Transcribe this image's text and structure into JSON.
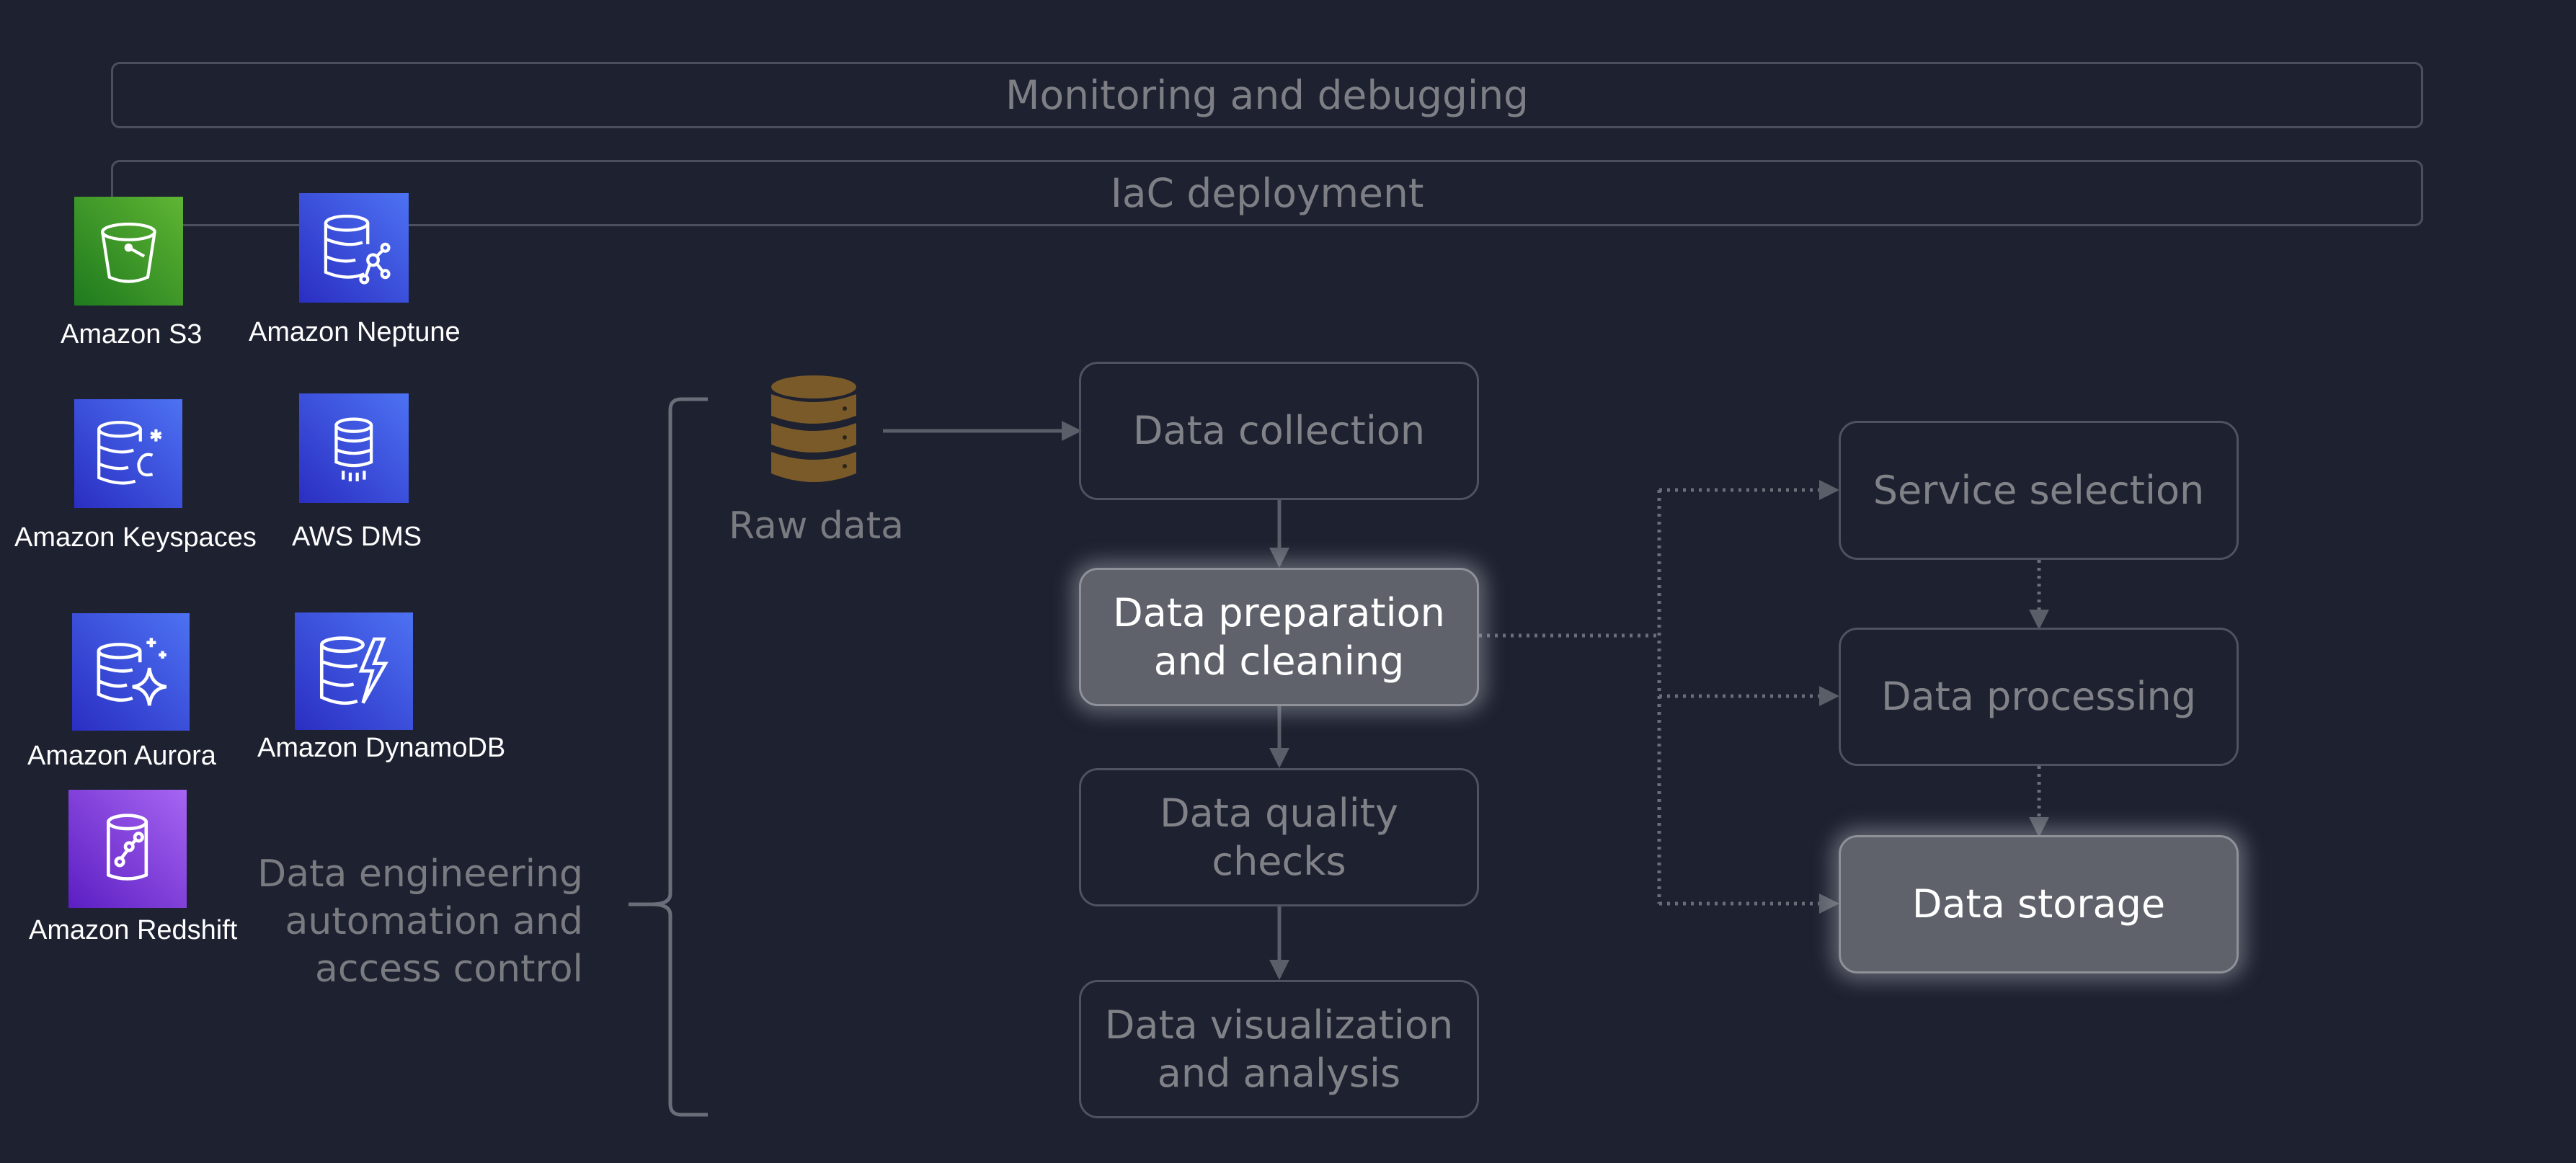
{
  "bars": {
    "monitoring": "Monitoring and debugging",
    "iac": "IaC deployment"
  },
  "services": [
    {
      "label": "Amazon S3",
      "icon": "s3-bucket-icon",
      "color": "#3f8624"
    },
    {
      "label": "Amazon Neptune",
      "icon": "neptune-graph-database-icon",
      "color": "#3b48cc"
    },
    {
      "label": "Amazon Keyspaces",
      "icon": "keyspaces-database-icon",
      "color": "#3b48cc"
    },
    {
      "label": "AWS DMS",
      "icon": "dms-database-icon",
      "color": "#3b48cc"
    },
    {
      "label": "Amazon Aurora",
      "icon": "aurora-database-icon",
      "color": "#3b48cc"
    },
    {
      "label": "Amazon DynamoDB",
      "icon": "dynamodb-icon",
      "color": "#3b48cc"
    },
    {
      "label": "Amazon Redshift",
      "icon": "redshift-icon",
      "color": "#8c4fff"
    }
  ],
  "automation": {
    "line1": "Data engineering",
    "line2": "automation and",
    "line3": "access control"
  },
  "raw_data": {
    "label": "Raw data",
    "icon": "database-stack-icon",
    "color": "#7a5a28"
  },
  "pipeline": {
    "collection": "Data collection",
    "prep_line1": "Data preparation",
    "prep_line2": "and cleaning",
    "quality_line1": "Data quality",
    "quality_line2": "checks",
    "viz_line1": "Data visualization",
    "viz_line2": "and analysis"
  },
  "branch": {
    "service_selection": "Service selection",
    "processing": "Data processing",
    "storage": "Data storage"
  },
  "colors": {
    "background": "#1d2130",
    "highlight": "#5f626b",
    "border": "#4e535f",
    "dim_text": "#808287"
  }
}
